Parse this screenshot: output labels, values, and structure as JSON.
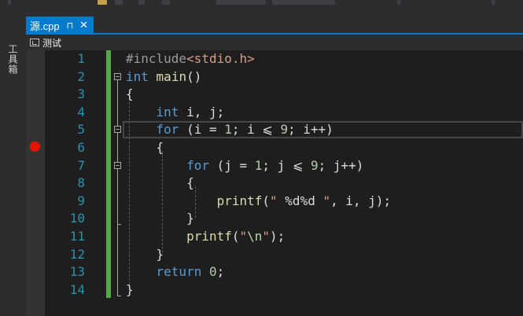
{
  "tool_window": {
    "toolbox_label": "工具箱"
  },
  "tab": {
    "filename": "源.cpp",
    "pin_glyph": "⊓",
    "close_glyph": "✕"
  },
  "nav": {
    "project": "测试"
  },
  "code": {
    "line_numbers": [
      "1",
      "2",
      "3",
      "4",
      "5",
      "6",
      "7",
      "8",
      "9",
      "10",
      "11",
      "12",
      "13",
      "14"
    ],
    "breakpoint_line": 6,
    "current_line": 5,
    "lines": [
      [
        {
          "t": "#include",
          "c": "pp"
        },
        {
          "t": "<stdio.h>",
          "c": "inc"
        }
      ],
      [
        {
          "t": "int",
          "c": "kw"
        },
        {
          "t": " "
        },
        {
          "t": "main",
          "c": "fn"
        },
        {
          "t": "()"
        }
      ],
      [
        {
          "t": "{"
        }
      ],
      [
        {
          "t": "    "
        },
        {
          "t": "int",
          "c": "kw"
        },
        {
          "t": " i, j;"
        }
      ],
      [
        {
          "t": "    "
        },
        {
          "t": "for",
          "c": "kw"
        },
        {
          "t": " (i = "
        },
        {
          "t": "1",
          "c": "num"
        },
        {
          "t": "; i ⩽ "
        },
        {
          "t": "9",
          "c": "num"
        },
        {
          "t": "; i++)"
        }
      ],
      [
        {
          "t": "    {"
        }
      ],
      [
        {
          "t": "        "
        },
        {
          "t": "for",
          "c": "kw"
        },
        {
          "t": " (j = "
        },
        {
          "t": "1",
          "c": "num"
        },
        {
          "t": "; j ⩽ "
        },
        {
          "t": "9",
          "c": "num"
        },
        {
          "t": "; j++)"
        }
      ],
      [
        {
          "t": "        {"
        }
      ],
      [
        {
          "t": "            "
        },
        {
          "t": "printf",
          "c": "fn"
        },
        {
          "t": "("
        },
        {
          "t": "\" ",
          "c": "str"
        },
        {
          "t": "%d%d",
          "c": "fmt"
        },
        {
          "t": " \"",
          "c": "str"
        },
        {
          "t": ", i, j);"
        }
      ],
      [
        {
          "t": "        }"
        }
      ],
      [
        {
          "t": "        "
        },
        {
          "t": "printf",
          "c": "fn"
        },
        {
          "t": "("
        },
        {
          "t": "\"",
          "c": "str"
        },
        {
          "t": "\\n",
          "c": "esc"
        },
        {
          "t": "\"",
          "c": "str"
        },
        {
          "t": ");"
        }
      ],
      [
        {
          "t": "    }"
        }
      ],
      [
        {
          "t": "    "
        },
        {
          "t": "return",
          "c": "kw"
        },
        {
          "t": " "
        },
        {
          "t": "0",
          "c": "num"
        },
        {
          "t": ";"
        }
      ],
      [
        {
          "t": "}"
        }
      ]
    ]
  }
}
